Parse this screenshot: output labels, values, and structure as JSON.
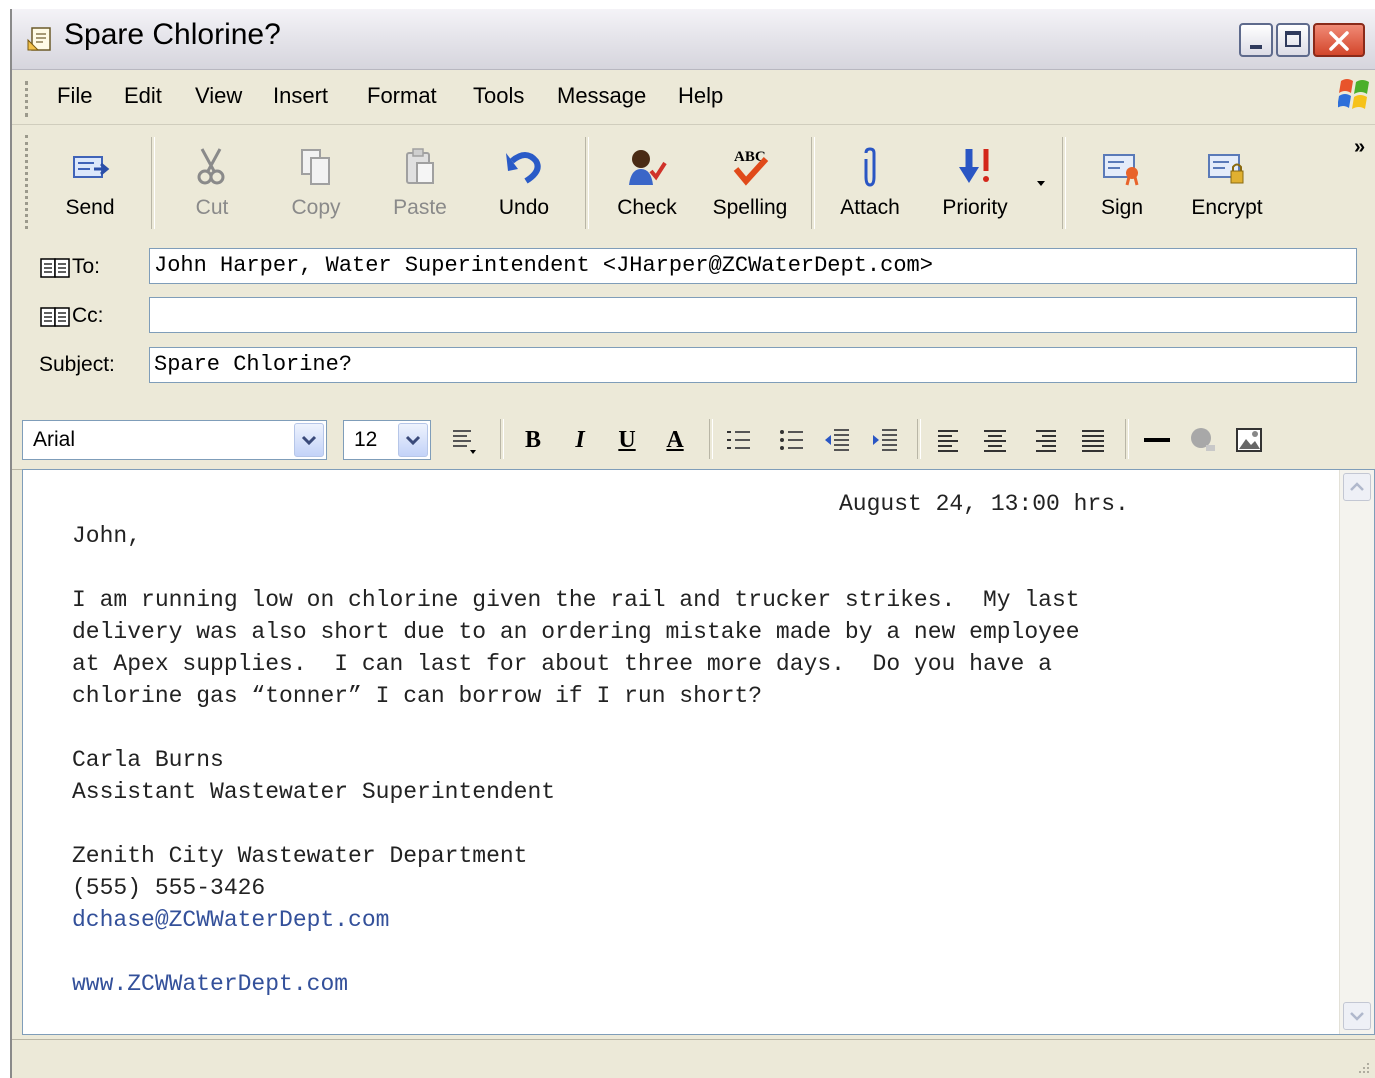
{
  "window": {
    "title": "Spare Chlorine?",
    "controls": [
      "minimize",
      "maximize",
      "close"
    ]
  },
  "menu": [
    "File",
    "Edit",
    "View",
    "Insert",
    "Format",
    "Tools",
    "Message",
    "Help"
  ],
  "toolbar": {
    "send": "Send",
    "cut": "Cut",
    "copy": "Copy",
    "paste": "Paste",
    "undo": "Undo",
    "check": "Check",
    "spelling": "Spelling",
    "attach": "Attach",
    "priority": "Priority",
    "sign": "Sign",
    "encrypt": "Encrypt",
    "overflow": "»"
  },
  "header": {
    "to_label": "To:",
    "to_value": "John Harper, Water Superintendent <JHarper@ZCWaterDept.com>",
    "cc_label": "Cc:",
    "cc_value": "",
    "subject_label": "Subject:",
    "subject_value": "Spare Chlorine?"
  },
  "format": {
    "font": "Arial",
    "size": "12",
    "bold": "B",
    "italic": "I",
    "underline": "U",
    "font_color": "A"
  },
  "body": {
    "date": "August 24, 13:00 hrs.",
    "greeting": "John,",
    "paragraph": [
      "I am running low on chlorine given the rail and trucker strikes.  My last",
      "delivery was also short due to an ordering mistake made by a new employee",
      "at Apex supplies.  I can last for about three more days.  Do you have a",
      "chlorine gas “tonner” I can borrow if I run short?"
    ],
    "signature_name": "Carla Burns",
    "signature_title": "Assistant Wastewater Superintendent",
    "department": "Zenith City Wastewater Department",
    "phone": "(555) 555-3426",
    "email": "dchase@ZCWWaterDept.com",
    "website": "www.ZCWWaterDept.com"
  },
  "colors": {
    "chrome": "#ece9d8",
    "input_border": "#7f9db9",
    "link": "#33509a"
  }
}
